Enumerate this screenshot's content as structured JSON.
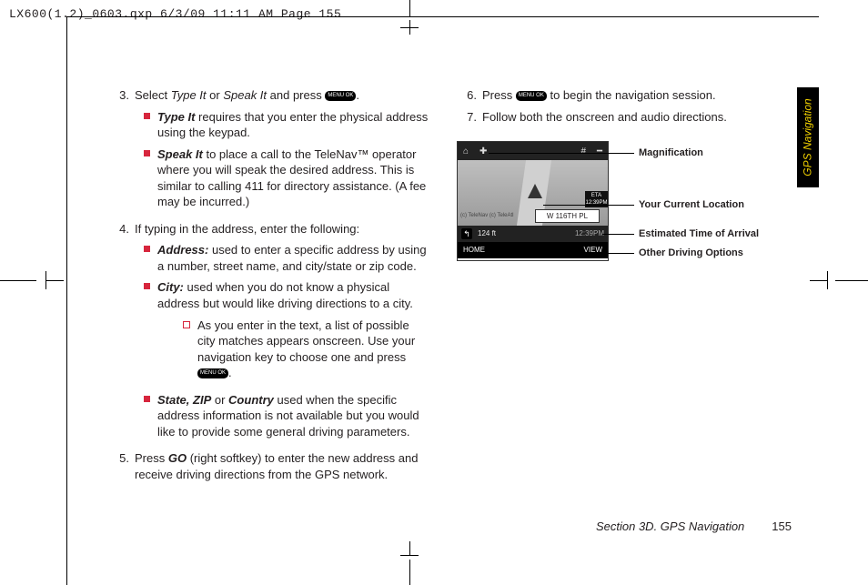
{
  "header_line": "LX600(1.2)_0603.qxp  6/3/09  11:11 AM  Page 155",
  "side_tab": "GPS Navigation",
  "footer": {
    "section": "Section 3D. GPS Navigation",
    "page": "155"
  },
  "ok_label": "MENU OK",
  "left": {
    "i3": {
      "num": "3.",
      "pre": "Select ",
      "a": "Type It",
      "mid": " or ",
      "b": "Speak It",
      "post": " and press ",
      "end": "."
    },
    "i3s1": {
      "b": "Type It",
      "t": " requires that you enter the physical address using the keypad."
    },
    "i3s2": {
      "b": "Speak It",
      "t": " to place a call to the TeleNav™ operator where you will speak the desired address. This is similar to calling 411 for directory assistance. (A fee may be incurred.)"
    },
    "i4": {
      "num": "4.",
      "t": "If typing in the address, enter the following:"
    },
    "i4s1": {
      "b": "Address:",
      "t": " used to enter a specific address by using a number, street name, and city/state or zip code."
    },
    "i4s2": {
      "b": "City:",
      "t": " used when you do not know a physical address but would like driving directions to a city."
    },
    "i4s2a": {
      "t": "As you enter in the text, a list of possible city matches appears onscreen. Use your navigation key to choose one and press ",
      "end": "."
    },
    "i4s3": {
      "b": "State, ZIP",
      "mid": " or ",
      "b2": "Country",
      "t": " used when the specific address information is not available but you would like to provide some general driving parameters."
    },
    "i5": {
      "num": "5.",
      "pre": "Press ",
      "b": "GO",
      "t": " (right softkey) to enter the new address and receive driving directions from the GPS network."
    }
  },
  "right": {
    "i6": {
      "num": "6.",
      "pre": "Press ",
      "post": " to begin the navigation session."
    },
    "i7": {
      "num": "7.",
      "t": "Follow both the onscreen and audio directions."
    }
  },
  "device": {
    "banner": "W 116TH PL",
    "eta_label": "ETA",
    "eta_time": "12:39PM",
    "dist": "124 ft",
    "bar_time": "12:39PM",
    "home": "HOME",
    "view": "VIEW",
    "copyright": "(c) TeleNav (c) TeleAtl"
  },
  "callouts": {
    "mag": "Magnification",
    "loc": "Your Current Location",
    "eta": "Estimated Time of Arrival",
    "opt": "Other Driving Options"
  }
}
